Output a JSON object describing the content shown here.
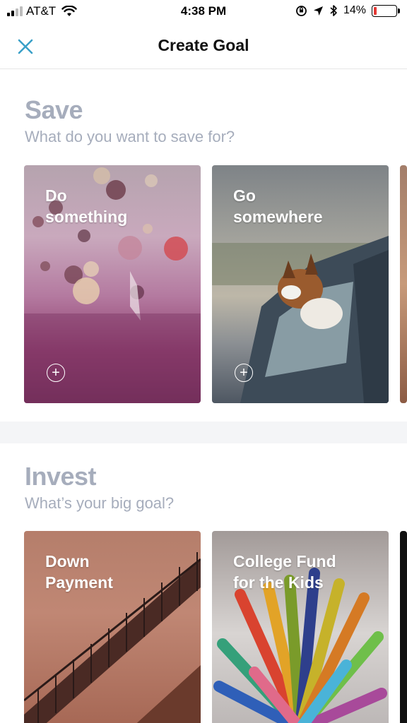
{
  "status_bar": {
    "carrier": "AT&T",
    "time": "4:38 PM",
    "battery_percent": "14%",
    "battery_level": 0.14
  },
  "nav": {
    "title": "Create Goal",
    "close_icon": "close-icon"
  },
  "save_section": {
    "title": "Save",
    "subtitle": "What do you want to save for?",
    "cards": [
      {
        "label": "Do\nsomething",
        "icon": "plus-circle-icon"
      },
      {
        "label": "Go\nsomewhere",
        "icon": "plus-circle-icon"
      }
    ]
  },
  "invest_section": {
    "title": "Invest",
    "subtitle": "What’s your big goal?",
    "cards": [
      {
        "label": "Down\nPayment"
      },
      {
        "label": "College Fund\nfor the Kids"
      }
    ]
  },
  "colors": {
    "accent": "#3aa0c8",
    "section_text": "#a6adbc",
    "battery_low": "#e53935"
  }
}
